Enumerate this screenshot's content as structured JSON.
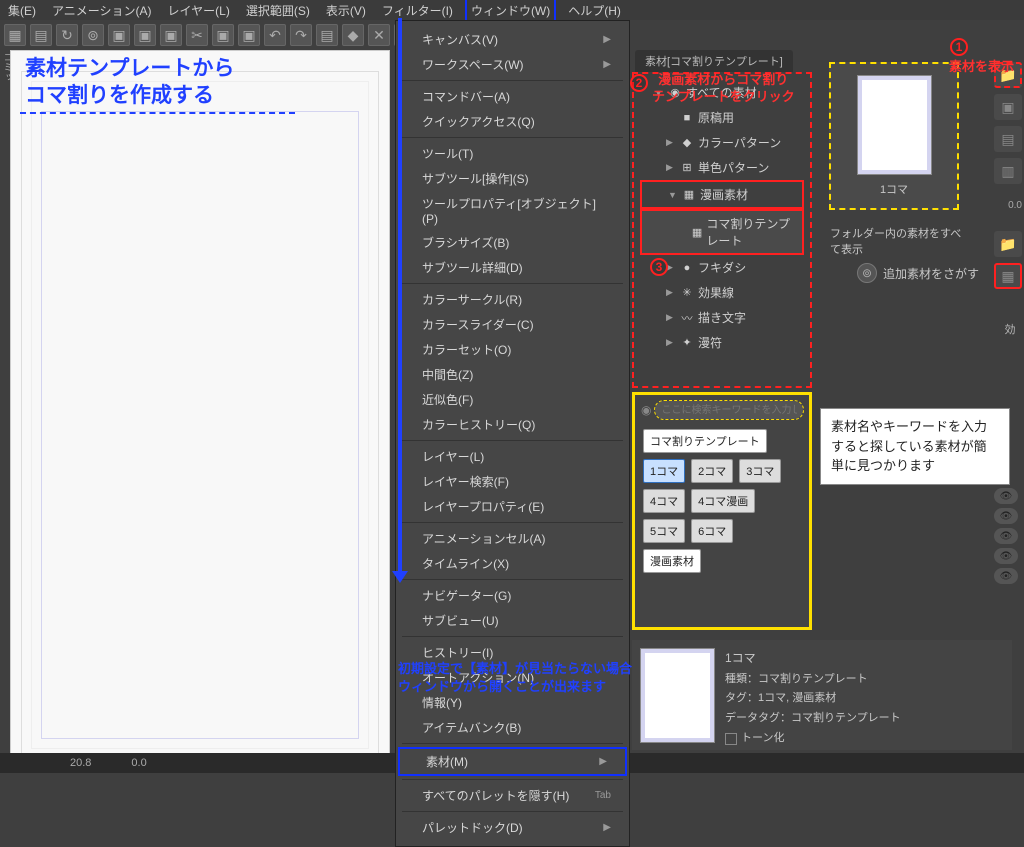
{
  "menubar": [
    "集(E)",
    "アニメーション(A)",
    "レイヤー(L)",
    "選択範囲(S)",
    "表示(V)",
    "フィルター(I)",
    "ウィンドウ(W)",
    "ヘルプ(H)"
  ],
  "menubar_highlight_index": 6,
  "title_overlay": "素材テンプレートから\nコマ割りを作成する",
  "dropdown": {
    "groups": [
      [
        [
          "キャンバス(V)",
          true
        ],
        [
          "ワークスペース(W)",
          true
        ]
      ],
      [
        [
          "コマンドバー(A)",
          false
        ],
        [
          "クイックアクセス(Q)",
          false
        ]
      ],
      [
        [
          "ツール(T)",
          false
        ],
        [
          "サブツール[操作](S)",
          false
        ],
        [
          "ツールプロパティ[オブジェクト](P)",
          false
        ],
        [
          "ブラシサイズ(B)",
          false
        ],
        [
          "サブツール詳細(D)",
          false
        ]
      ],
      [
        [
          "カラーサークル(R)",
          false
        ],
        [
          "カラースライダー(C)",
          false
        ],
        [
          "カラーセット(O)",
          false
        ],
        [
          "中間色(Z)",
          false
        ],
        [
          "近似色(F)",
          false
        ],
        [
          "カラーヒストリー(Q)",
          false
        ]
      ],
      [
        [
          "レイヤー(L)",
          false
        ],
        [
          "レイヤー検索(F)",
          false
        ],
        [
          "レイヤープロパティ(E)",
          false
        ]
      ],
      [
        [
          "アニメーションセル(A)",
          false
        ],
        [
          "タイムライン(X)",
          false
        ]
      ],
      [
        [
          "ナビゲーター(G)",
          false
        ],
        [
          "サブビュー(U)",
          false
        ]
      ],
      [
        [
          "ヒストリー(I)",
          false
        ],
        [
          "オートアクション(N)",
          false
        ],
        [
          "情報(Y)",
          false
        ],
        [
          "アイテムバンク(B)",
          false
        ]
      ],
      [
        [
          "素材(M)",
          true
        ]
      ],
      [
        [
          "すべてのパレットを隠す(H)",
          false,
          "Tab"
        ]
      ],
      [
        [
          "パレットドック(D)",
          true
        ]
      ]
    ],
    "highlight_blue_label": "素材(M)"
  },
  "blue_note": "初期設定で【素材】が見当たらない場合\nウィンドウから開くことが出来ます",
  "tree_header": "すべての素材",
  "tree": [
    {
      "label": "原稿用",
      "icon": "■",
      "indent": 1,
      "arrow": ""
    },
    {
      "label": "カラーパターン",
      "icon": "◆",
      "indent": 1,
      "arrow": "▶"
    },
    {
      "label": "単色パターン",
      "icon": "⊞",
      "indent": 1,
      "arrow": "▶"
    },
    {
      "label": "漫画素材",
      "icon": "▦",
      "indent": 0,
      "arrow": "▼",
      "highlight": "red"
    },
    {
      "label": "コマ割りテンプレート",
      "icon": "▦",
      "indent": 1,
      "arrow": "",
      "highlight": "red2"
    },
    {
      "label": "フキダシ",
      "icon": "●",
      "indent": 1,
      "arrow": "▶"
    },
    {
      "label": "効果線",
      "icon": "✳",
      "indent": 1,
      "arrow": "▶"
    },
    {
      "label": "描き文字",
      "icon": "〰",
      "indent": 1,
      "arrow": "▶"
    },
    {
      "label": "漫符",
      "icon": "✦",
      "indent": 1,
      "arrow": "▶"
    }
  ],
  "annotations": {
    "a1": "素材を表示",
    "a2": "漫画素材からコマ割り\nテンプレートをクリック"
  },
  "preview_caption": "1コマ",
  "hint_below_preview": "フォルダー内の素材をすべて表示",
  "hint_search_more": "追加素材をさがす",
  "search": {
    "placeholder": "ここに検索キーワードを入力してくださ",
    "section_label": "コマ割りテンプレート",
    "tags_rows": [
      [
        {
          "t": "1コマ",
          "sel": true
        },
        {
          "t": "2コマ"
        },
        {
          "t": "3コマ"
        }
      ],
      [
        {
          "t": "4コマ"
        },
        {
          "t": "4コマ漫画"
        }
      ],
      [
        {
          "t": "5コマ"
        },
        {
          "t": "6コマ"
        }
      ]
    ],
    "extra_label": "漫画素材"
  },
  "white_note": "素材名やキーワードを入力すると探している素材が簡単に見つかります",
  "detail": {
    "title": "1コマ",
    "type_label": "種類：",
    "type_value": "コマ割りテンプレート",
    "tag_label": "タグ：",
    "tag_value": "1コマ, 漫画素材",
    "datatag_label": "データタグ：",
    "datatag_value": "コマ割りテンプレート",
    "tone_label": "トーン化"
  },
  "tab_header": "素材[コマ割りテンプレート]",
  "status": {
    "left": "20.8",
    "right": "0.0"
  },
  "right_numbers": "0.0",
  "right_labels": [
    "表",
    "効"
  ],
  "left_label": "コミッ"
}
